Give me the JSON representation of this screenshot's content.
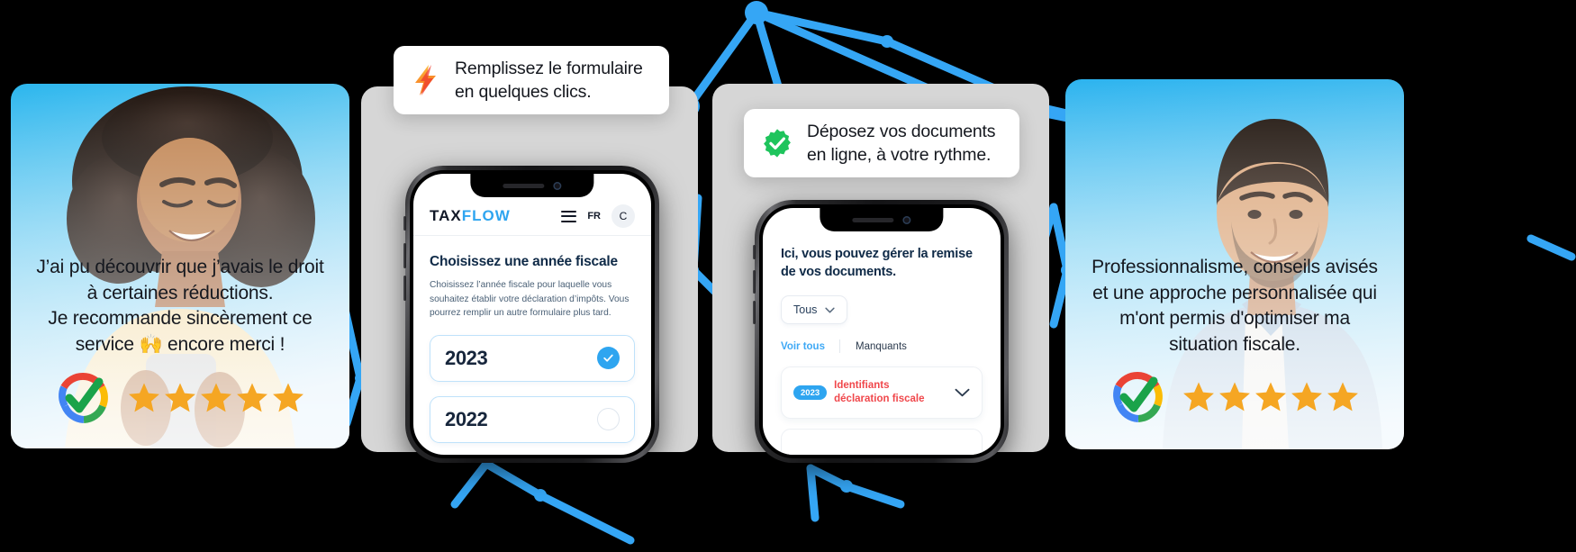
{
  "theme": {
    "brand_blue": "#2ea5f0",
    "network_blue": "#35a6f5",
    "panel_grey": "#d6d6d6",
    "star_gold": "#f5a623",
    "doc_red": "#f0474b",
    "badge_green": "#1ec45c",
    "bg": "#000000"
  },
  "testimonial_left": {
    "name": "testimonial-card-left",
    "quote": "J’ai pu découvrir que j’avais le droit\nà certaines réductions.\nJe recommande sincèrement ce\nservice 🙌 encore merci !",
    "quote_lines": [
      "J’ai pu découvrir que j’avais le droit",
      "à certaines réductions.",
      "Je recommande sincèrement ce",
      "service 🙌 encore merci !"
    ],
    "rating_stars": 5,
    "trust_badge": "google-review-check-badge"
  },
  "testimonial_right": {
    "name": "testimonial-card-right",
    "quote_lines": [
      "Professionnalisme, conseils avisés",
      "et une approche personnalisée qui",
      "m'ont permis d'optimiser ma",
      "situation fiscale."
    ],
    "rating_stars": 5,
    "trust_badge": "google-review-check-badge"
  },
  "callout_form": {
    "icon": "lightning-bolt-icon",
    "lines": [
      "Remplissez le formulaire",
      "en quelques clics."
    ]
  },
  "callout_docs": {
    "icon": "green-verified-check-icon",
    "lines": [
      "Déposez vos documents",
      "en ligne, à votre rythme."
    ]
  },
  "phone_one": {
    "appbar": {
      "logo_tax": "TAX",
      "logo_flow": "FLOW",
      "menu_icon": "hamburger-menu-icon",
      "language": "FR",
      "avatar_initial": "C"
    },
    "heading": "Choisissez une année fiscale",
    "paragraph": "Choisissez l’année fiscale pour laquelle vous souhaitez établir votre déclaration d’impôts. Vous pourrez remplir un autre formulaire plus tard.",
    "year_options": [
      {
        "label": "2023",
        "selected": true
      },
      {
        "label": "2022",
        "selected": false
      }
    ]
  },
  "phone_two": {
    "heading_lines": [
      "Ici, vous pouvez gérer la remise",
      "de vos documents."
    ],
    "filter_select": {
      "value": "Tous",
      "icon": "chevron-down-icon"
    },
    "tabs": [
      {
        "label": "Voir tous",
        "active": true
      },
      {
        "label": "Manquants",
        "active": false
      }
    ],
    "documents": [
      {
        "year_chip": "2023",
        "title_lines": [
          "Identifiants",
          "déclaration fiscale"
        ],
        "expand_icon": "chevron-down-icon"
      }
    ]
  }
}
